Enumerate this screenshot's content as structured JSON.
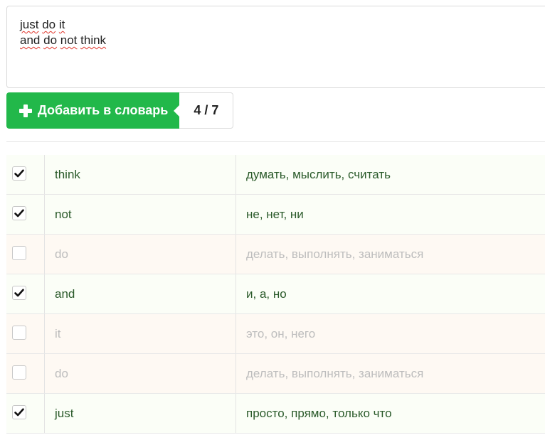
{
  "input": {
    "lines": [
      [
        "just",
        "do",
        "it"
      ],
      [
        "and",
        "do",
        "not",
        "think"
      ]
    ],
    "line1": "just do it",
    "line2": "and do not think"
  },
  "add_button": {
    "icon": "plus-icon",
    "label": "Добавить в словарь"
  },
  "counter": "4 / 7",
  "colors": {
    "accent": "#22b84a",
    "checked_text": "#2a5a2a",
    "unchecked_text": "#bdbdbd"
  },
  "words": [
    {
      "checked": true,
      "word": "think",
      "translation": "думать, мыслить, считать"
    },
    {
      "checked": true,
      "word": "not",
      "translation": "не, нет, ни"
    },
    {
      "checked": false,
      "word": "do",
      "translation": "делать, выполнять, заниматься"
    },
    {
      "checked": true,
      "word": "and",
      "translation": "и, а, но"
    },
    {
      "checked": false,
      "word": "it",
      "translation": "это, он, него"
    },
    {
      "checked": false,
      "word": "do",
      "translation": "делать, выполнять, заниматься"
    },
    {
      "checked": true,
      "word": "just",
      "translation": "просто, прямо, только что"
    }
  ]
}
